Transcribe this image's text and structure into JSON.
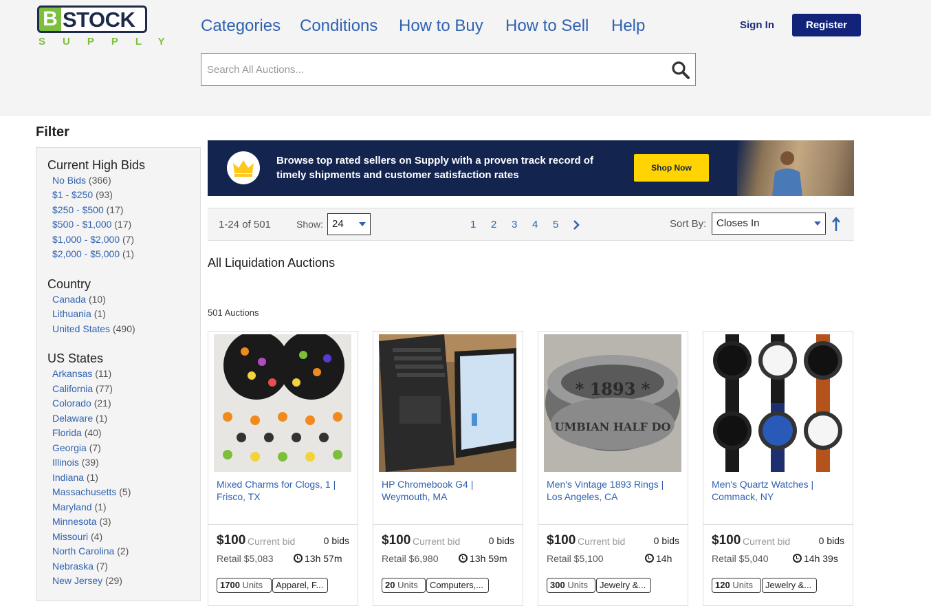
{
  "logo": {
    "b": "B",
    "stock": "STOCK",
    "supply": "SUPPLY"
  },
  "nav": {
    "categories": "Categories",
    "conditions": "Conditions",
    "how_to_buy": "How to Buy",
    "how_to_sell": "How to Sell",
    "help": "Help",
    "sign_in": "Sign In",
    "register": "Register"
  },
  "search": {
    "placeholder": "Search All Auctions..."
  },
  "filter": {
    "title": "Filter",
    "bids": {
      "title": "Current High Bids",
      "items": [
        {
          "label": "No Bids",
          "count": "(366)"
        },
        {
          "label": "$1 - $250",
          "count": "(93)"
        },
        {
          "label": "$250 - $500",
          "count": "(17)"
        },
        {
          "label": "$500 - $1,000",
          "count": "(17)"
        },
        {
          "label": "$1,000 - $2,000",
          "count": "(7)"
        },
        {
          "label": "$2,000 - $5,000",
          "count": "(1)"
        }
      ]
    },
    "country": {
      "title": "Country",
      "items": [
        {
          "label": "Canada",
          "count": "(10)"
        },
        {
          "label": "Lithuania",
          "count": "(1)"
        },
        {
          "label": "United States",
          "count": "(490)"
        }
      ]
    },
    "states": {
      "title": "US States",
      "items": [
        {
          "label": "Arkansas",
          "count": "(11)"
        },
        {
          "label": "California",
          "count": "(77)"
        },
        {
          "label": "Colorado",
          "count": "(21)"
        },
        {
          "label": "Delaware",
          "count": "(1)"
        },
        {
          "label": "Florida",
          "count": "(40)"
        },
        {
          "label": "Georgia",
          "count": "(7)"
        },
        {
          "label": "Illinois",
          "count": "(39)"
        },
        {
          "label": "Indiana",
          "count": "(1)"
        },
        {
          "label": "Massachusetts",
          "count": "(5)"
        },
        {
          "label": "Maryland",
          "count": "(1)"
        },
        {
          "label": "Minnesota",
          "count": "(3)"
        },
        {
          "label": "Missouri",
          "count": "(4)"
        },
        {
          "label": "North Carolina",
          "count": "(2)"
        },
        {
          "label": "Nebraska",
          "count": "(7)"
        },
        {
          "label": "New Jersey",
          "count": "(29)"
        }
      ]
    }
  },
  "banner": {
    "line1": "Browse top rated sellers on Supply with a proven track record of",
    "line2": "timely shipments and customer satisfaction rates",
    "cta": "Shop Now"
  },
  "toolbar": {
    "range": "1-24 of 501",
    "show_label": "Show:",
    "show_value": "24",
    "pages": [
      "1",
      "2",
      "3",
      "4",
      "5"
    ],
    "sort_label": "Sort By:",
    "sort_value": "Closes In"
  },
  "section_title": "All Liquidation Auctions",
  "auction_count": "501 Auctions",
  "cards": [
    {
      "title": "Mixed Charms for Clogs, 1 | Frisco, TX",
      "price": "$100",
      "price_label": "Current bid",
      "bids": "0 bids",
      "retail": "Retail $5,083",
      "time": "13h 57m",
      "units": "1700",
      "units_label": "Units",
      "category": "Apparel, F..."
    },
    {
      "title": "HP Chromebook G4 | Weymouth, MA",
      "price": "$100",
      "price_label": "Current bid",
      "bids": "0 bids",
      "retail": "Retail $6,980",
      "time": "13h 59m",
      "units": "20",
      "units_label": "Units",
      "category": "Computers,..."
    },
    {
      "title": "Men's Vintage 1893 Rings | Los Angeles, CA",
      "price": "$100",
      "price_label": "Current bid",
      "bids": "0 bids",
      "retail": "Retail $5,100",
      "time": "14h",
      "units": "300",
      "units_label": "Units",
      "category": "Jewelry &..."
    },
    {
      "title": "Men's Quartz Watches | Commack, NY",
      "price": "$100",
      "price_label": "Current bid",
      "bids": "0 bids",
      "retail": "Retail $5,040",
      "time": "14h 39s",
      "units": "120",
      "units_label": "Units",
      "category": "Jewelry &..."
    }
  ],
  "colors": {
    "link": "#2f62b0",
    "navy": "#12247a",
    "brand_green": "#7cbf3b",
    "banner_bg": "#13244f",
    "cta": "#ffd400"
  }
}
